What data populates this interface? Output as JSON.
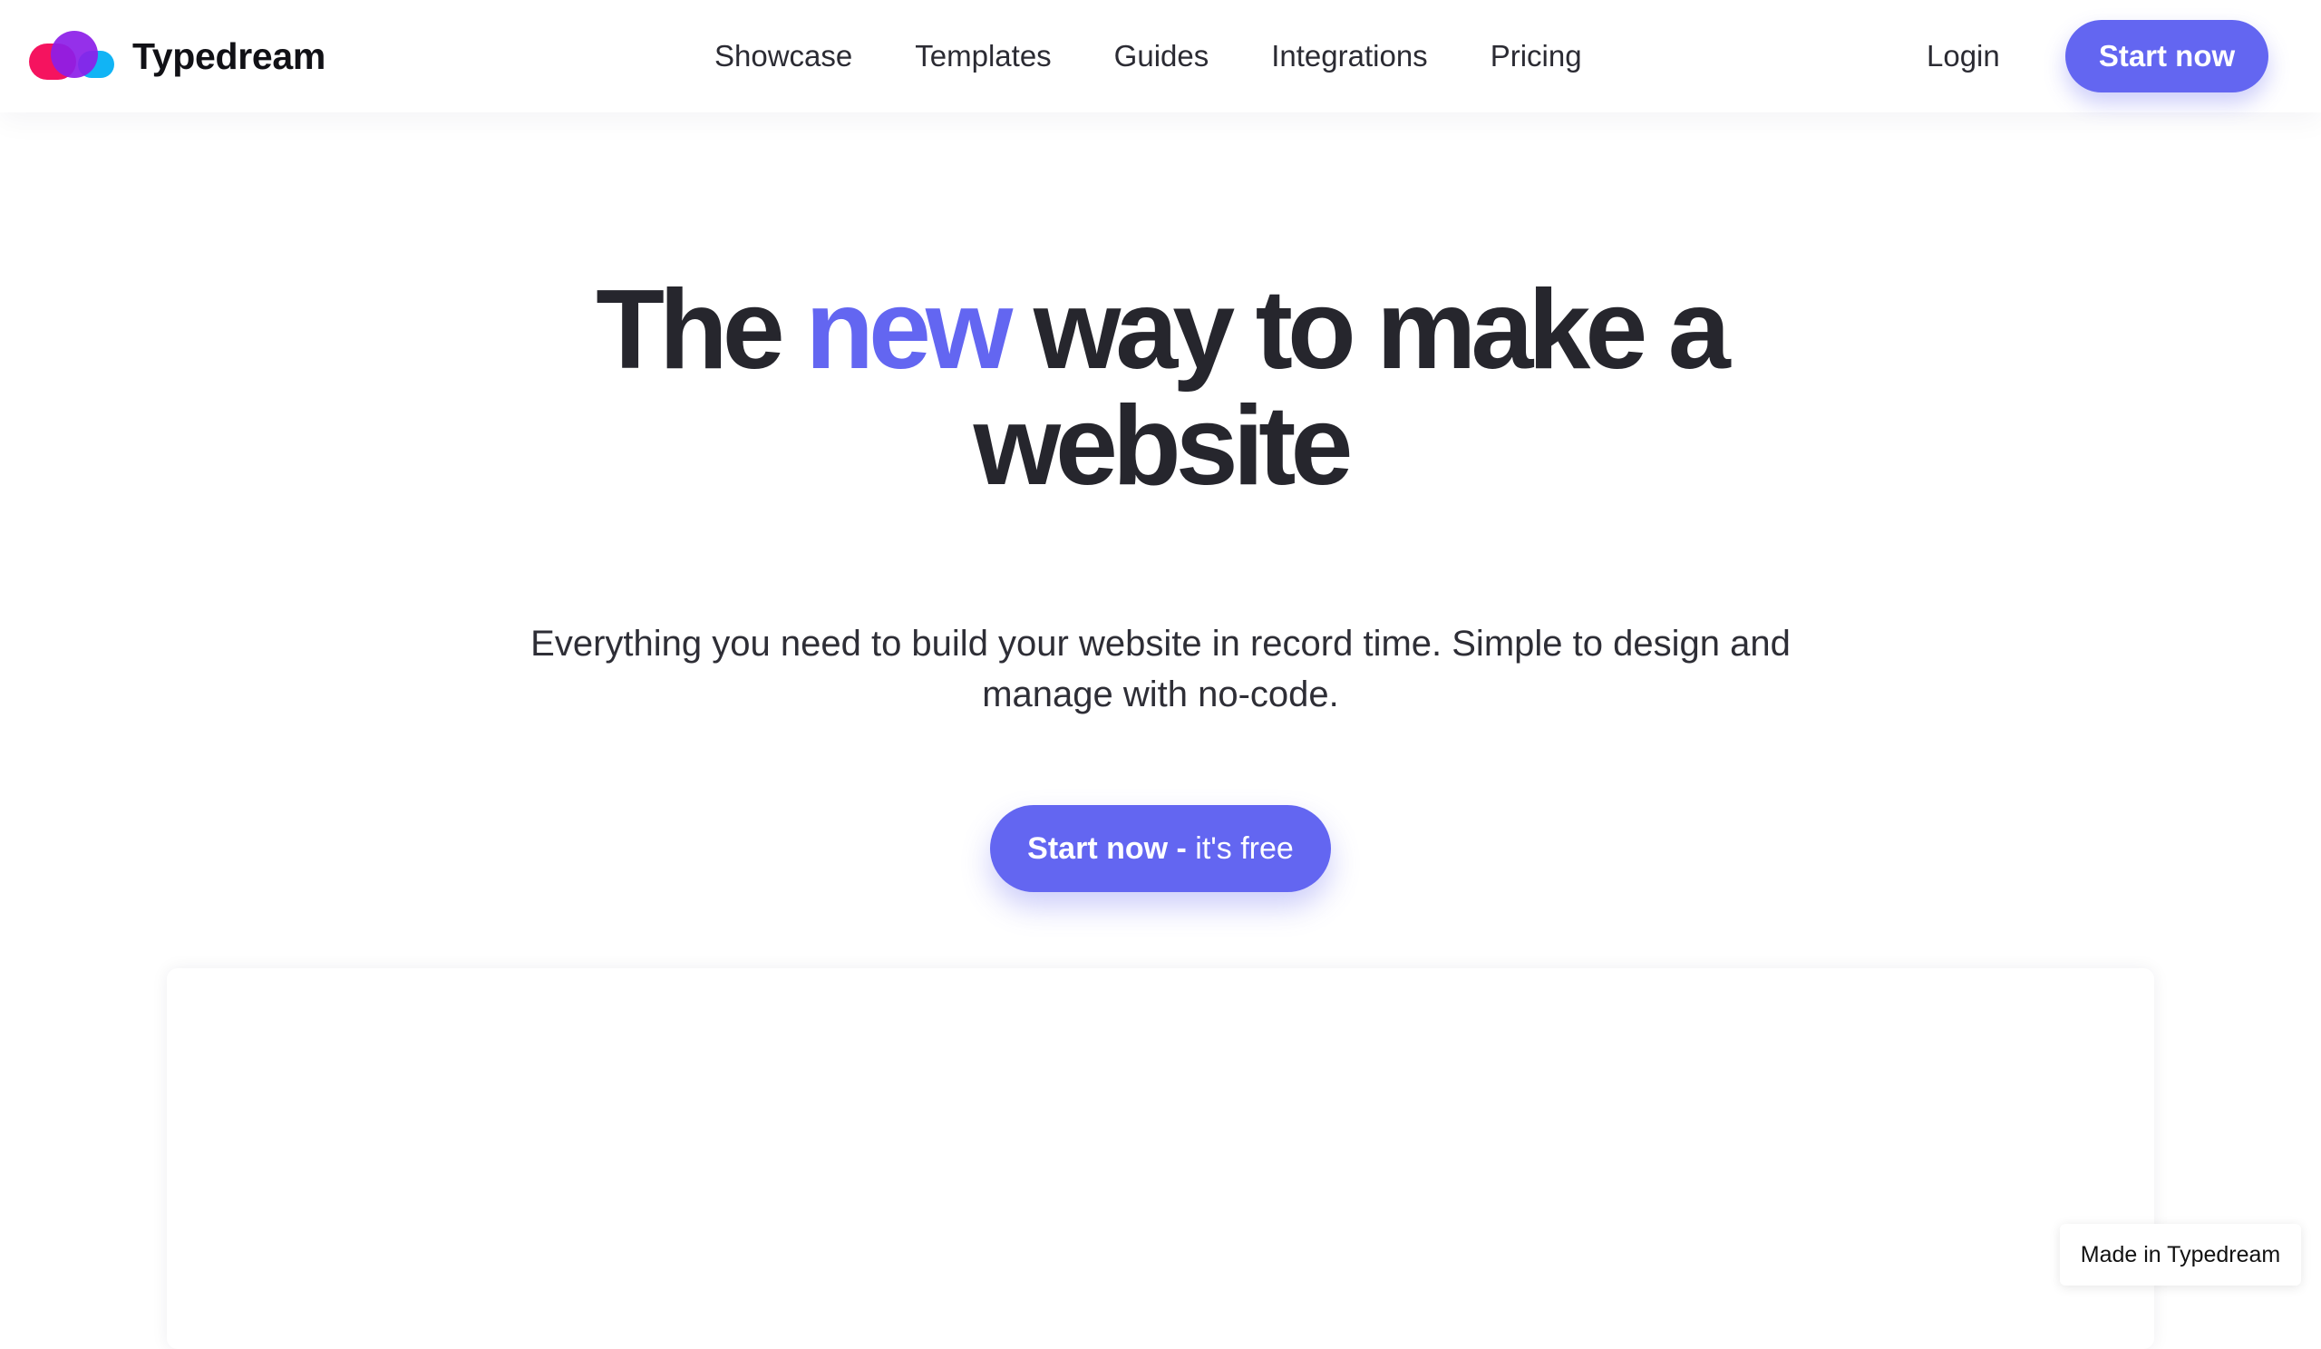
{
  "header": {
    "brand_name": "Typedream",
    "logo_icon": "typedream-cloud-logo",
    "nav": {
      "showcase": "Showcase",
      "templates": "Templates",
      "guides": "Guides",
      "integrations": "Integrations",
      "pricing": "Pricing"
    },
    "login_label": "Login",
    "start_label": "Start now"
  },
  "hero": {
    "title_part1": "The ",
    "title_accent": "new",
    "title_part2": " way to make a website",
    "subtitle": "Everything you need to build your website in record time. Simple to design and manage with no-code.",
    "cta_strong": "Start now - ",
    "cta_light": "it's free"
  },
  "badge": {
    "label": "Made in Typedream"
  },
  "colors": {
    "accent": "#6366f1",
    "text": "#26262d",
    "logo_pink": "#f5135f",
    "logo_purple": "#8c1ee8",
    "logo_blue": "#11b4f5"
  }
}
